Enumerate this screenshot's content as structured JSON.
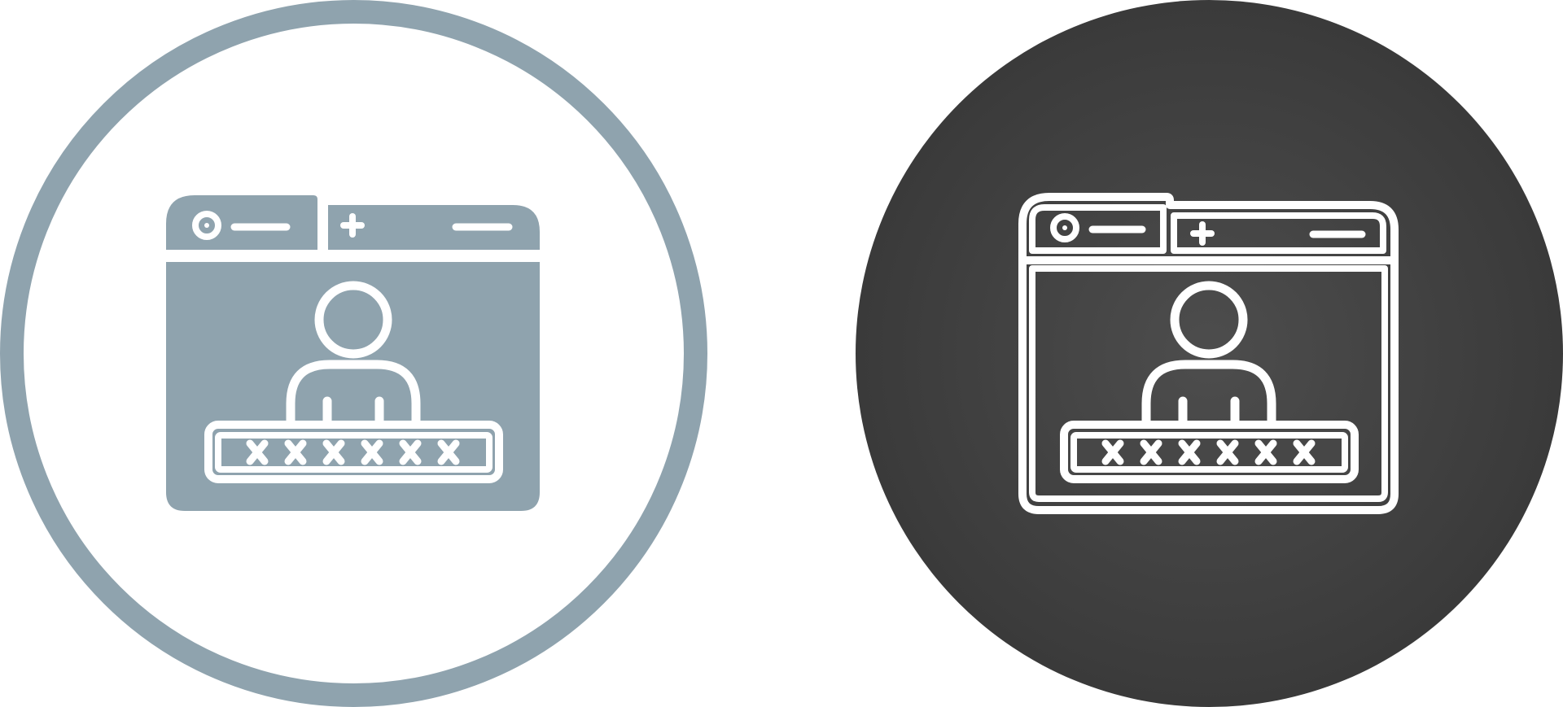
{
  "icons": [
    {
      "id": "left",
      "style": "glyph",
      "icon": "browser-user-login-icon",
      "ring_color": "#8fa3ae",
      "fill_color": "#ffffff",
      "glyph_color": "#8fa3ae",
      "line_color": "#ffffff",
      "password_mask_count": 6
    },
    {
      "id": "right",
      "style": "outline",
      "icon": "browser-user-login-icon",
      "fill_color_inner": "#4d4d4d",
      "fill_color_outer": "#3a3a3a",
      "line_color": "#ffffff",
      "password_mask_count": 6
    }
  ]
}
